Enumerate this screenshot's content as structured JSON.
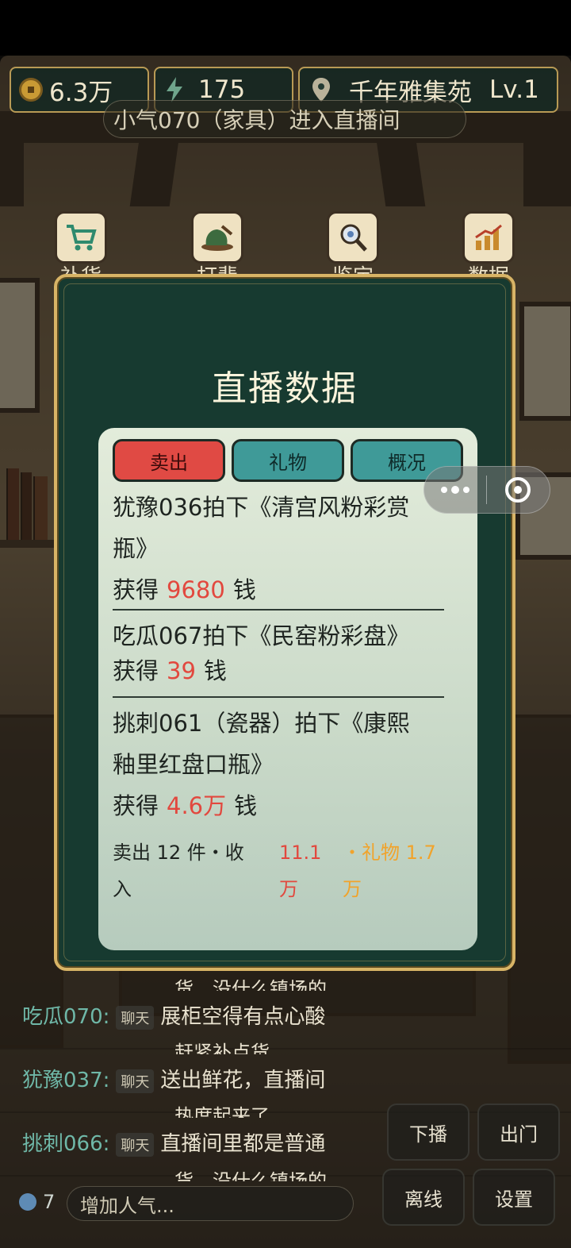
{
  "hud": {
    "coins": "6.3万",
    "energy": "175",
    "shop_name": "千年雅集苑",
    "level": "Lv.1"
  },
  "announcement": "小气070（家具）进入直播间",
  "toolbar": {
    "items": [
      {
        "label": "补货",
        "icon": "shopping-cart-icon"
      },
      {
        "label": "打翡翠",
        "icon": "jade-stone-icon"
      },
      {
        "label": "鉴定",
        "icon": "magnifier-icon"
      },
      {
        "label": "数据",
        "icon": "bar-chart-icon"
      }
    ]
  },
  "modal": {
    "title": "直播数据",
    "tabs": [
      "卖出",
      "礼物",
      "概况"
    ],
    "active_tab": "卖出",
    "records": [
      {
        "line1": "犹豫036拍下《清宫风粉彩赏",
        "line2": "瓶》",
        "earn_prefix": "获得",
        "amount": "9680",
        "earn_suffix": "钱"
      },
      {
        "line1": "吃瓜067拍下《民窑粉彩盘》",
        "earn_prefix": "获得",
        "amount": "39",
        "earn_suffix": "钱"
      },
      {
        "line1": "挑刺061（瓷器）拍下《康熙",
        "line2": "釉里红盘口瓶》",
        "earn_prefix": "获得",
        "amount": "4.6万",
        "earn_suffix": "钱"
      }
    ],
    "summary": {
      "sold_line1": "卖出 12 件・收",
      "sold_line2": "入",
      "income_line1": "11.1",
      "income_line2": "万",
      "gift_line1": "・礼物 1.7",
      "gift_line2": "万"
    }
  },
  "chat": {
    "rows": [
      {
        "name": "吃瓜070:",
        "tag": "聊天",
        "msg": "展柜空得有点心酸",
        "cont": "赶紧补点货。"
      },
      {
        "name": "犹豫037:",
        "tag": "聊天",
        "msg": "送出鲜花，直播间",
        "cont": "热度起来了。"
      },
      {
        "name": "挑刺066:",
        "tag": "聊天",
        "msg": "直播间里都是普通",
        "cont": "货，没什么镇场的"
      }
    ],
    "top_cont": "货，没什么镇场的"
  },
  "bottom": {
    "viewers": "7",
    "boost_placeholder": "增加人气...",
    "buttons": {
      "end_stream": "下播",
      "go_out": "出门",
      "offline": "离线",
      "settings": "设置"
    }
  },
  "colors": {
    "modal_bg": "#173a30",
    "modal_border": "#d8b466",
    "tab_active": "#e04a44",
    "tab_inactive": "#3f9a98",
    "amount_red": "#e2483e",
    "gift_orange": "#f1a32b"
  }
}
